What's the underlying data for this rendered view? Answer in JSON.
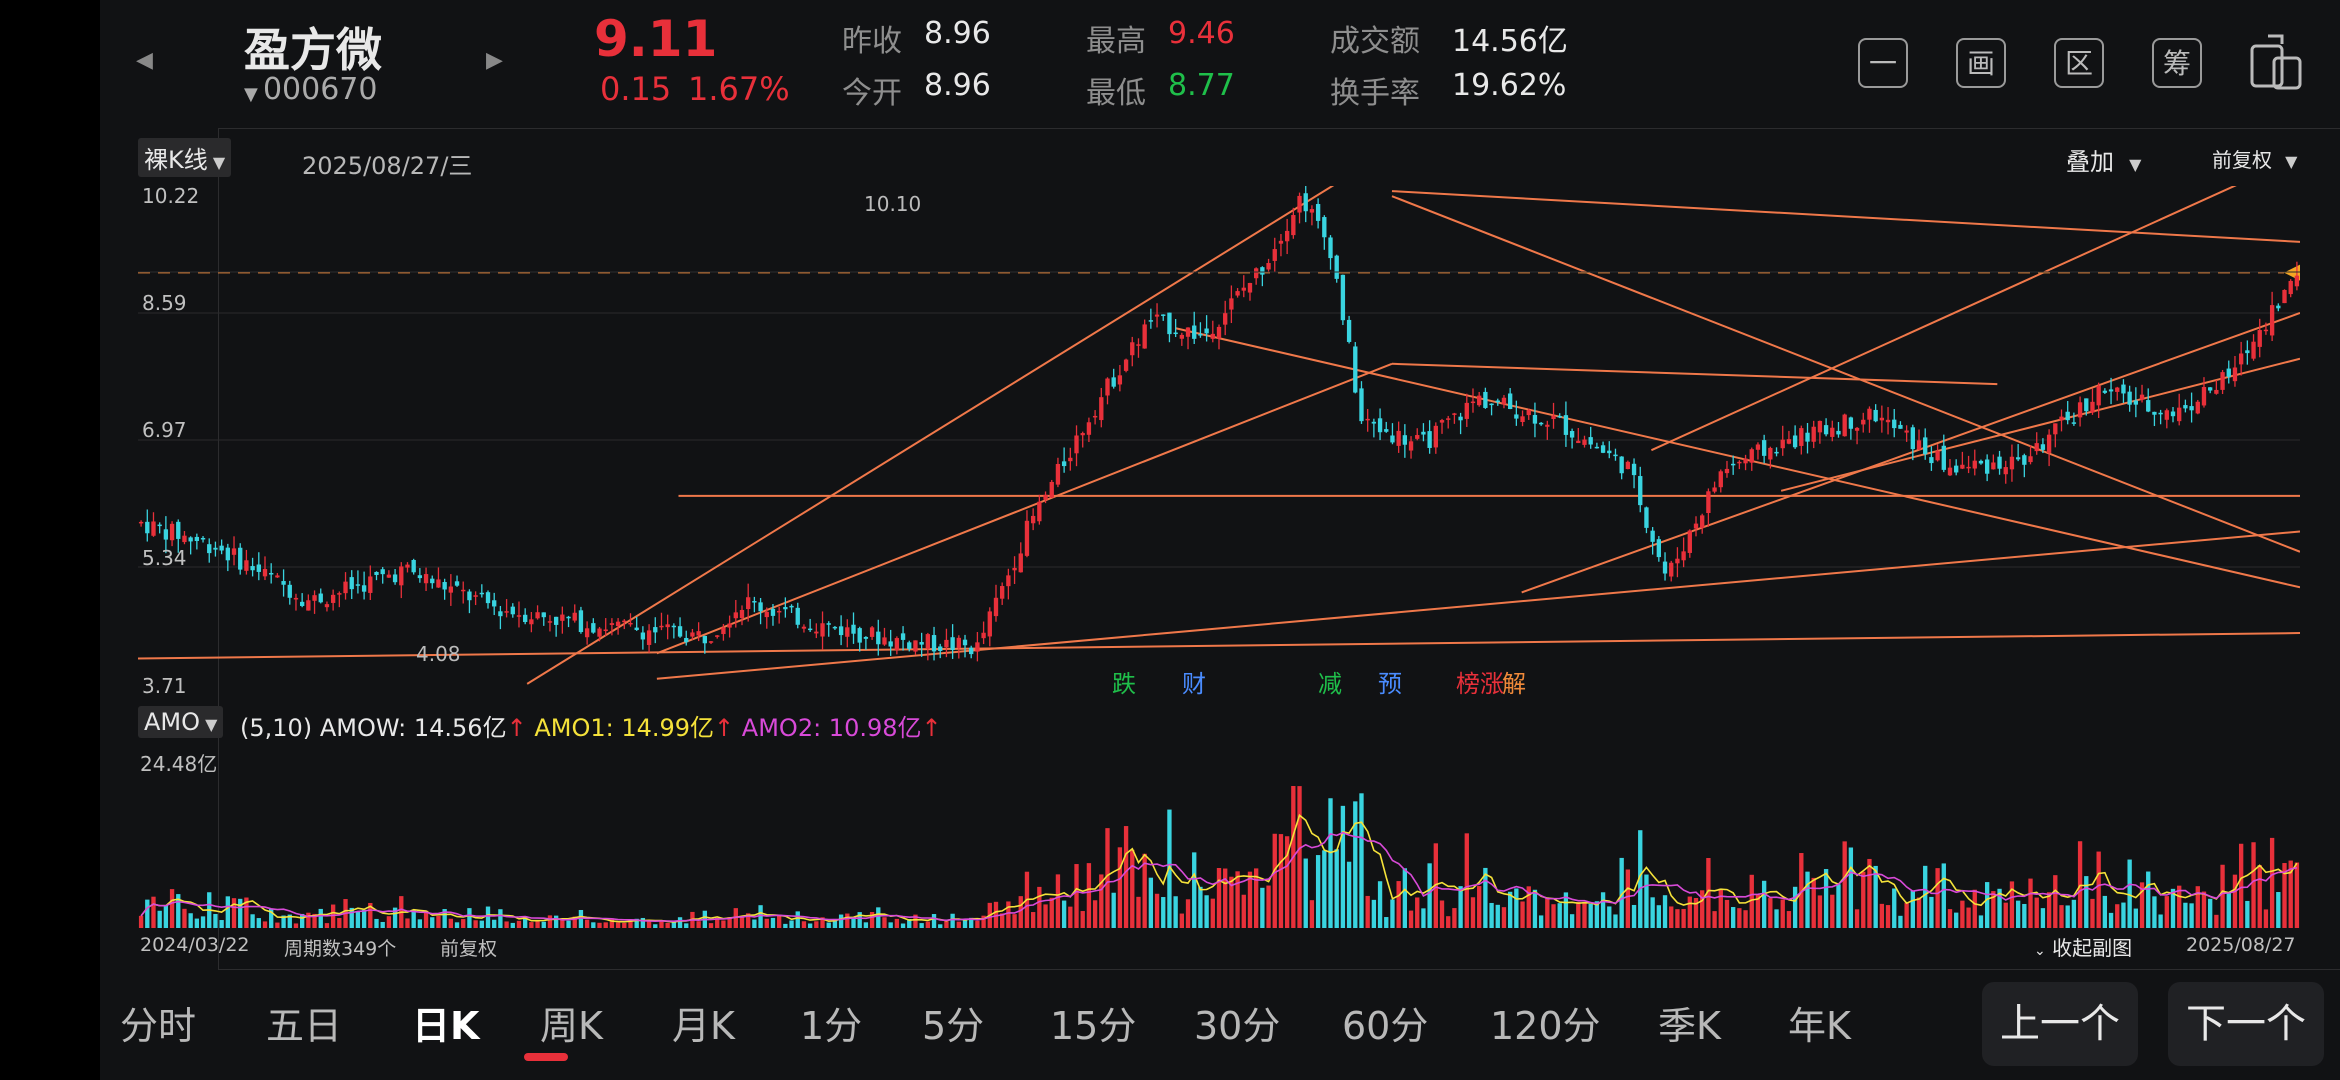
{
  "header": {
    "name": "盈方微",
    "code": "000670",
    "price": "9.11",
    "change": "0.15",
    "change_pct": "1.67%",
    "prev_close_label": "昨收",
    "prev_close": "8.96",
    "open_label": "今开",
    "open": "8.96",
    "high_label": "最高",
    "high": "9.46",
    "low_label": "最低",
    "low": "8.77",
    "amount_label": "成交额",
    "amount": "14.56亿",
    "turnover_label": "换手率",
    "turnover": "19.62%",
    "tools": [
      "一",
      "画",
      "区",
      "筹"
    ]
  },
  "kline": {
    "mode": "裸K线",
    "date": "2025/08/27/三",
    "overlay": "叠加",
    "adjust": "前复权",
    "y_ticks": [
      "10.22",
      "8.59",
      "6.97",
      "5.34",
      "3.71"
    ],
    "high_mark": "10.10",
    "low_mark": "4.08",
    "events": [
      "跌",
      "财",
      "减",
      "预",
      "榜",
      "涨",
      "解"
    ]
  },
  "amo": {
    "label": "AMO",
    "params": "(5,10)",
    "amow": "AMOW: 14.56亿",
    "amo1": "AMO1: 14.99亿",
    "amo2": "AMO2: 10.98亿",
    "max": "24.48亿"
  },
  "footer": {
    "start": "2024/03/22",
    "periods": "周期数349个",
    "adjust": "前复权",
    "collapse": "收起副图",
    "end": "2025/08/27"
  },
  "tabs": [
    "分时",
    "五日",
    "日K",
    "周K",
    "月K",
    "1分",
    "5分",
    "15分",
    "30分",
    "60分",
    "120分",
    "季K",
    "年K"
  ],
  "active_tab": "日K",
  "prev_button": "上一个",
  "next_button": "下一个",
  "chart_data": {
    "type": "candlestick",
    "x_range": [
      "2024/03/22",
      "2025/08/27"
    ],
    "ylim": [
      3.71,
      10.22
    ],
    "last_close": 9.11,
    "periods": 349,
    "peak": 10.1,
    "trough": 4.08,
    "colors": {
      "up": "#e8303a",
      "down": "#39d4e0",
      "trend": "#f0784a",
      "amo1": "#f5e23a",
      "amo2": "#d84ad8"
    }
  }
}
